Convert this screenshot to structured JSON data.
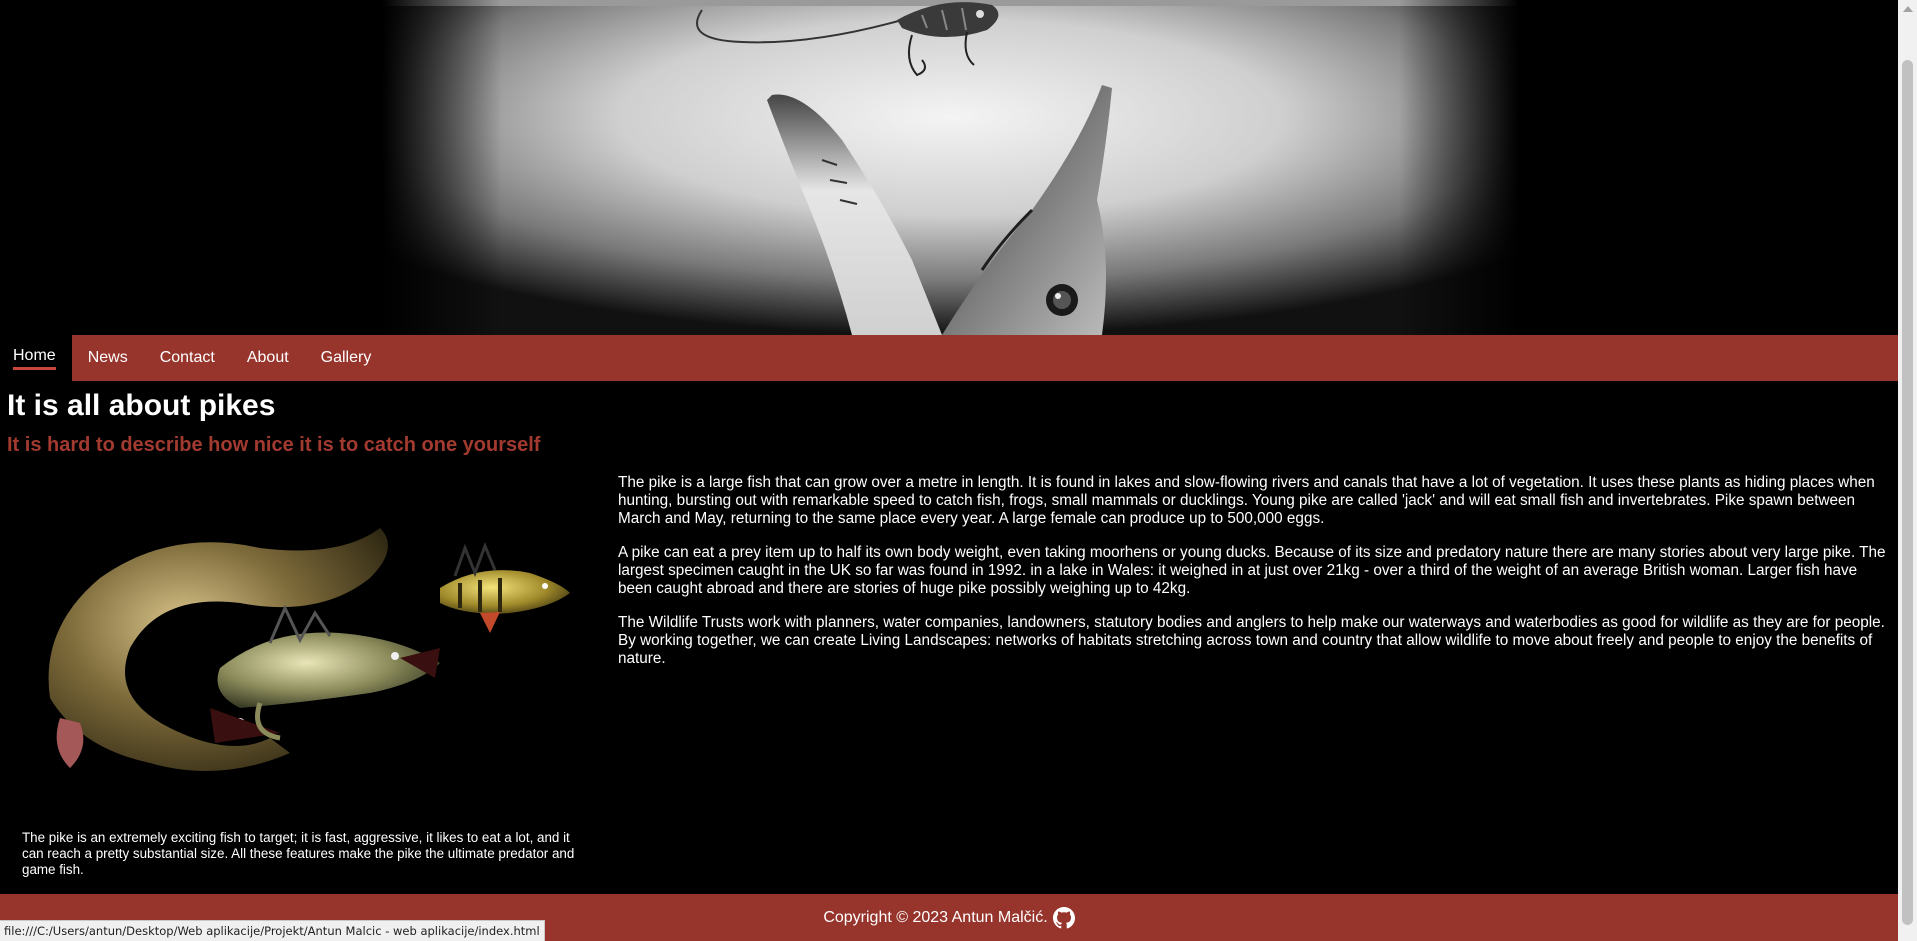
{
  "nav": {
    "items": [
      {
        "label": "Home",
        "active": true
      },
      {
        "label": "News"
      },
      {
        "label": "Contact"
      },
      {
        "label": "About"
      },
      {
        "label": "Gallery"
      }
    ]
  },
  "main": {
    "title": "It is all about pikes",
    "subtitle": "It is hard to describe how nice it is to catch one yourself",
    "left_caption": "The pike is an extremely exciting fish to target; it is fast, aggressive, it likes to eat a lot, and it can reach a pretty substantial size. All these features make the pike the ultimate predator and game fish.",
    "paragraphs": [
      "The pike is a large fish that can grow over a metre in length. It is found in lakes and slow-flowing rivers and canals that have a lot of vegetation. It uses these plants as hiding places when hunting, bursting out with remarkable speed to catch fish, frogs, small mammals or ducklings. Young pike are called 'jack' and will eat small fish and invertebrates. Pike spawn between March and May, returning to the same place every year. A large female can produce up to 500,000 eggs.",
      "A pike can eat a prey item up to half its own body weight, even taking moorhens or young ducks. Because of its size and predatory nature there are many stories about very large pike. The largest specimen caught in the UK so far was found in 1992. in a lake in Wales: it weighed in at just over 21kg - over a third of the weight of an average British woman. Larger fish have been caught abroad and there are stories of huge pike possibly weighing up to 42kg.",
      "The Wildlife Trusts work with planners, water companies, landowners, statutory bodies and anglers to help make our waterways and waterbodies as good for wildlife as they are for people. By working together, we can create Living Landscapes: networks of habitats stretching across town and country that allow wildlife to move about freely and people to enjoy the benefits of nature."
    ]
  },
  "footer": {
    "copyright": "Copyright © 2023 Antun Malčić.",
    "icon": "github-icon"
  },
  "statusbar": {
    "url": "file:///C:/Users/antun/Desktop/Web aplikacije/Projekt/Antun Malcic - web aplikacije/index.html"
  },
  "colors": {
    "accent": "#97352d",
    "subtitle": "#a23a30",
    "background": "#000000"
  }
}
